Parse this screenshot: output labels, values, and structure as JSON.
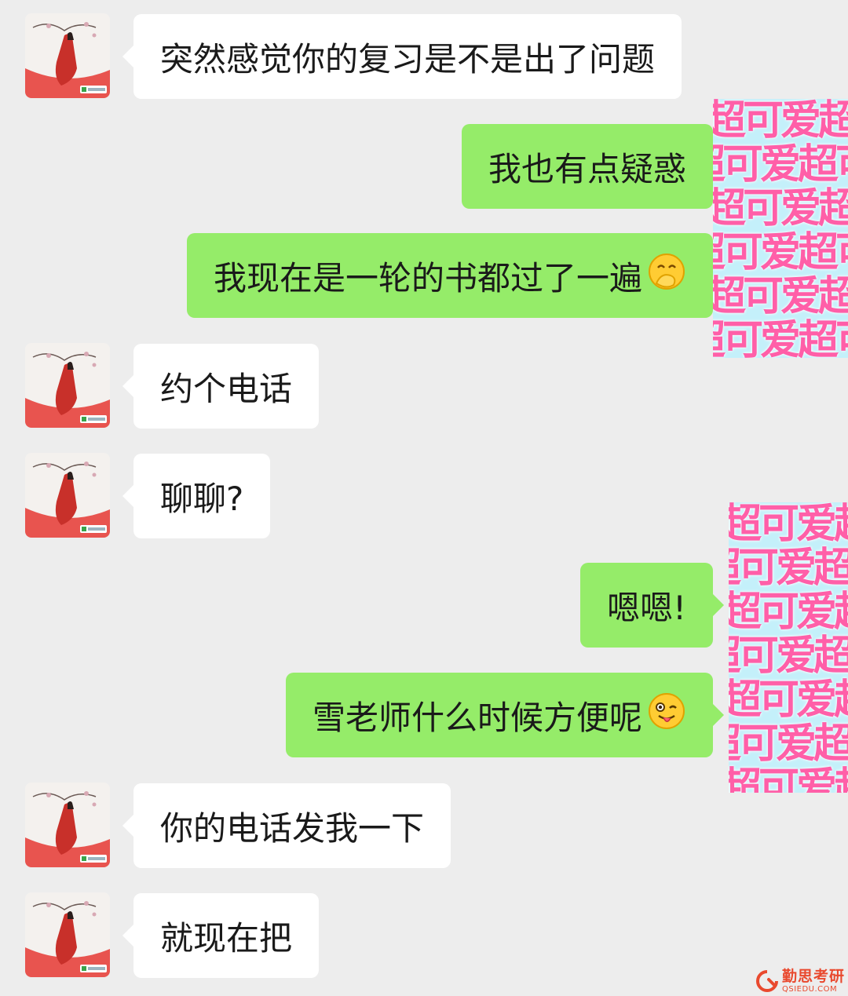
{
  "messages": [
    {
      "side": "in",
      "text": "突然感觉你的复习是不是出了问题",
      "emoji": ""
    },
    {
      "side": "out",
      "text": "我也有点疑惑",
      "emoji": ""
    },
    {
      "side": "out",
      "text": "我现在是一轮的书都过了一遍",
      "emoji": "covering-mouth-emoji"
    },
    {
      "side": "in",
      "text": "约个电话",
      "emoji": ""
    },
    {
      "side": "in",
      "text": "聊聊?",
      "emoji": ""
    },
    {
      "side": "out",
      "text": "嗯嗯!",
      "emoji": ""
    },
    {
      "side": "out",
      "text": "雪老师什么时候方便呢",
      "emoji": "winking-tongue-emoji"
    },
    {
      "side": "in",
      "text": "你的电话发我一下",
      "emoji": ""
    },
    {
      "side": "in",
      "text": "就现在把",
      "emoji": ""
    }
  ],
  "sticker": {
    "text": "超可爱超可爱"
  },
  "watermark": {
    "name": "勤思考研",
    "domain": "QSIEDU.COM"
  },
  "colors": {
    "outgoing": "#95ec69",
    "incoming": "#ffffff",
    "background": "#ededed",
    "brand": "#e9492e"
  }
}
